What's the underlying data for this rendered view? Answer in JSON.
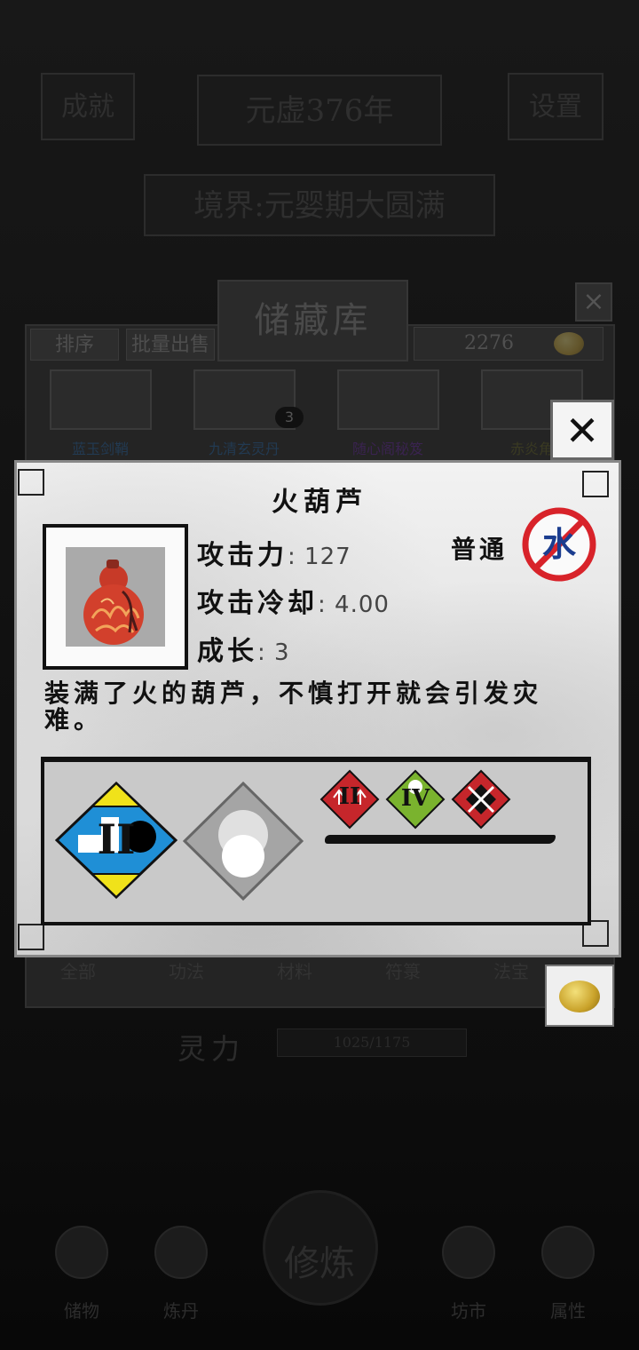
{
  "background": {
    "year_banner": "元虚376年",
    "left_button": "成就",
    "right_button": "设置",
    "realm_banner": "境界:元婴期大圆满",
    "storage": {
      "title": "储藏库",
      "sort_label": "排序",
      "batch_sell_label": "批量出售",
      "gold_amount": "2276",
      "slot_count_badge": "3",
      "slot_labels": [
        "蓝玉剑鞘",
        "九清玄灵丹",
        "随心阁秘笈",
        "赤炎角"
      ],
      "bottom_tabs": [
        "全部",
        "功法",
        "材料",
        "符箓",
        "法宝"
      ]
    },
    "power_label": "灵力",
    "power_value": "1025/1175",
    "nav": [
      "储物",
      "炼丹",
      "修炼",
      "坊市",
      "属性"
    ]
  },
  "dialog": {
    "item_name": "火葫芦",
    "attack_label": "攻击力",
    "attack_value": ": 127",
    "cooldown_label": "攻击冷却",
    "cooldown_value": ": 4.00",
    "growth_label": "成长",
    "growth_value": ": 3",
    "grade": "普通",
    "weakness_element": "水",
    "description": "装满了火的葫芦，不慎打开就会引发灾难。",
    "skill_badges": {
      "main_numeral": "II",
      "small": [
        "II",
        "IV",
        ""
      ]
    }
  },
  "colors": {
    "weakness_red": "#d8232a",
    "weakness_blue": "#1b3d8f",
    "badge_red": "#c6262b",
    "badge_green": "#7ab32e",
    "badge_blue": "#1f8fd6",
    "badge_yellow": "#f0e21a",
    "gourd_red": "#d2402c"
  }
}
